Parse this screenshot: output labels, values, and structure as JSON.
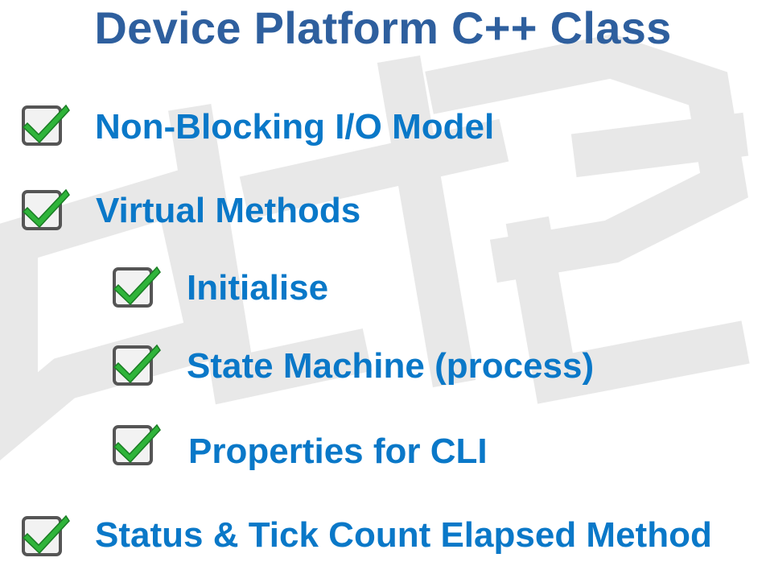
{
  "title": "Device Platform C++ Class",
  "colors": {
    "title": "#2e5f9e",
    "item_text": "#0a78c8",
    "check_green": "#2fb43a",
    "checkbox_border": "#555555",
    "watermark": "#e2e2e2"
  },
  "checklist": [
    {
      "label": "Non-Blocking I/O Model",
      "checked": true,
      "level": 1,
      "icon": "checked-box-icon"
    },
    {
      "label": "Virtual Methods",
      "checked": true,
      "level": 1,
      "icon": "checked-box-icon"
    },
    {
      "label": "Initialise",
      "checked": true,
      "level": 2,
      "icon": "checked-box-icon"
    },
    {
      "label": "State Machine (process)",
      "checked": true,
      "level": 2,
      "icon": "checked-box-icon"
    },
    {
      "label": "Properties for CLI",
      "checked": true,
      "level": 2,
      "icon": "checked-box-icon"
    },
    {
      "label": "Status & Tick Count Elapsed Method",
      "checked": true,
      "level": 1,
      "icon": "checked-box-icon"
    }
  ]
}
